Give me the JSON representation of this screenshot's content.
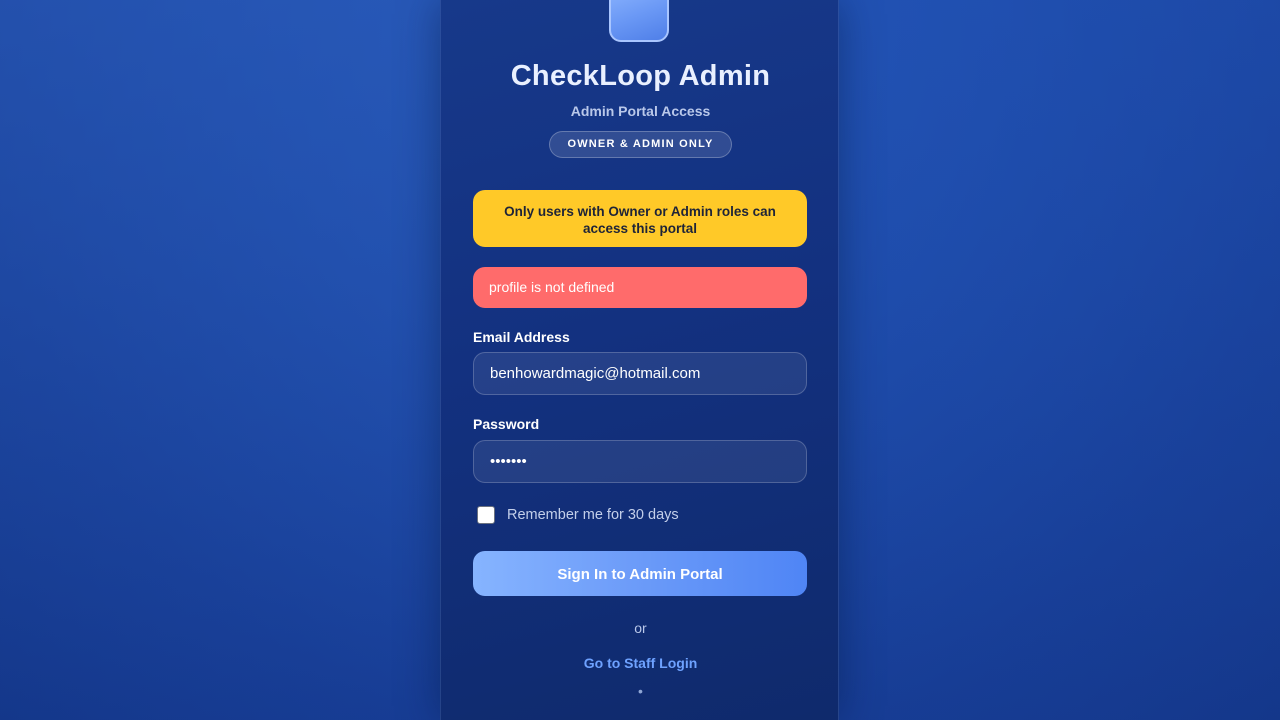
{
  "header": {
    "title": "CheckLoop Admin",
    "subtitle": "Admin Portal Access",
    "badge": "OWNER & ADMIN ONLY"
  },
  "alerts": {
    "warning": "Only users with Owner or Admin roles can access this portal",
    "error": "profile is not defined"
  },
  "form": {
    "email_label": "Email Address",
    "email_value": "benhowardmagic@hotmail.com",
    "password_label": "Password",
    "password_value": "•••••••",
    "remember_label": "Remember me for 30 days",
    "remember_checked": false,
    "submit_label": "Sign In to Admin Portal"
  },
  "footer": {
    "or_text": "or",
    "staff_link": "Go to Staff Login",
    "dot": "•"
  },
  "colors": {
    "warning_bg": "#ffc928",
    "error_bg": "#ff6b6b",
    "link": "#6ea2ff",
    "button_gradient_start": "#86b4ff",
    "button_gradient_end": "#4f85f5"
  },
  "icons": {
    "logo": "app-logo-icon"
  }
}
